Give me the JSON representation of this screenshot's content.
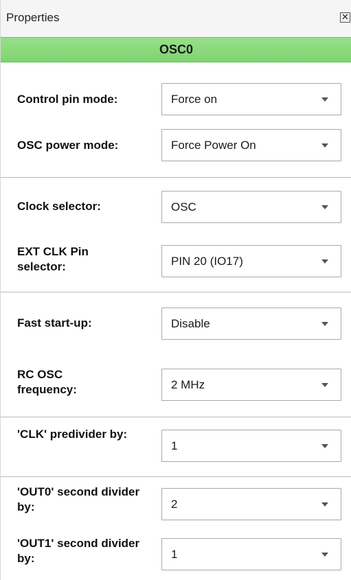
{
  "window": {
    "title": "Properties",
    "close_glyph": "✕"
  },
  "header": {
    "title": "OSC0",
    "color": "#7fd370"
  },
  "fields": [
    {
      "label": "Control pin mode:",
      "value": "Force on"
    },
    {
      "label": "OSC power mode:",
      "value": "Force Power On"
    },
    {
      "label": "Clock selector:",
      "value": "OSC"
    },
    {
      "label": "EXT CLK Pin selector:",
      "value": "PIN 20 (IO17)"
    },
    {
      "label": "Fast start-up:",
      "value": "Disable"
    },
    {
      "label": "RC OSC frequency:",
      "value": "2 MHz"
    },
    {
      "label": "'CLK' predivider by:",
      "value": "1"
    },
    {
      "label": "'OUT0' second divider by:",
      "value": "2"
    },
    {
      "label": "'OUT1' second divider by:",
      "value": "1"
    }
  ],
  "icons": {
    "dropdown": "chevron-down-icon",
    "close": "close-icon"
  }
}
